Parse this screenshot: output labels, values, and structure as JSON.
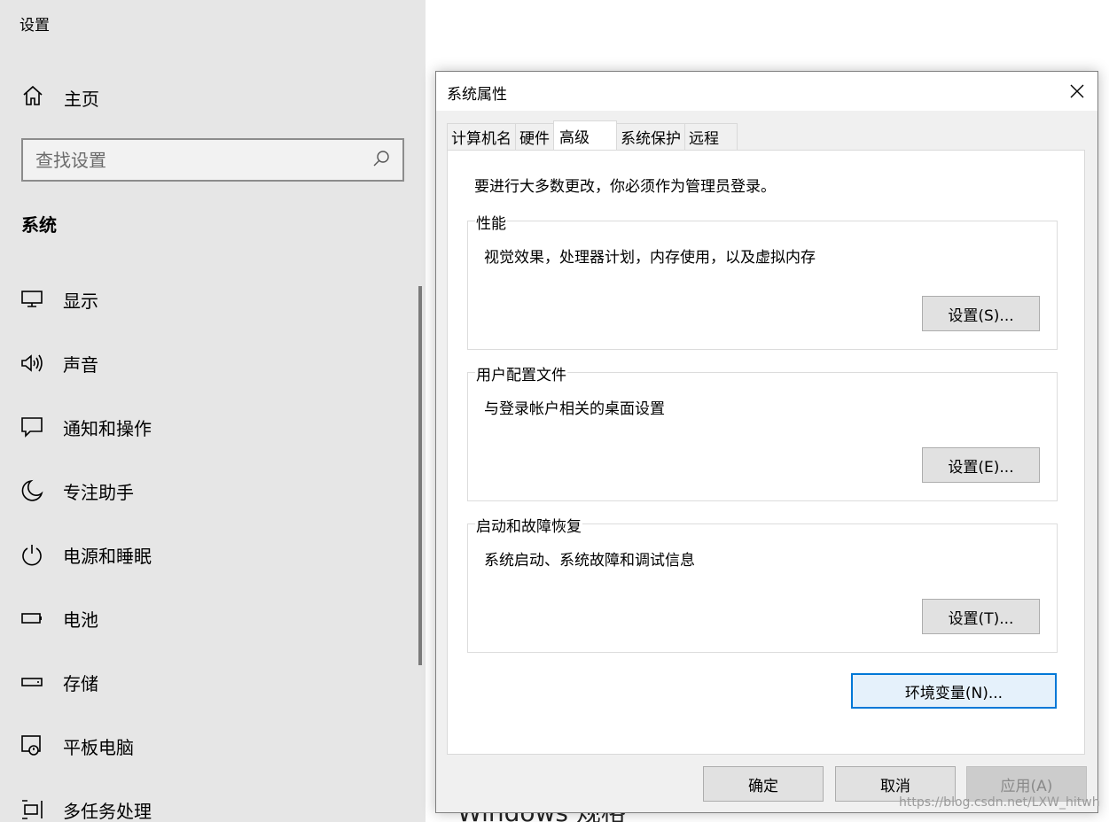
{
  "settings": {
    "app_title": "设置",
    "home_label": "主页",
    "search_placeholder": "查找设置",
    "section_title": "系统",
    "nav_items": [
      {
        "label": "显示",
        "icon": "monitor-icon"
      },
      {
        "label": "声音",
        "icon": "speaker-icon"
      },
      {
        "label": "通知和操作",
        "icon": "message-icon"
      },
      {
        "label": "专注助手",
        "icon": "moon-icon"
      },
      {
        "label": "电源和睡眠",
        "icon": "power-icon"
      },
      {
        "label": "电池",
        "icon": "battery-icon"
      },
      {
        "label": "存储",
        "icon": "storage-icon"
      },
      {
        "label": "平板电脑",
        "icon": "tablet-icon"
      },
      {
        "label": "多任务处理",
        "icon": "multitask-icon"
      }
    ],
    "background_text": "Windows 规格"
  },
  "dialog": {
    "title": "系统属性",
    "tabs": [
      {
        "label": "计算机名",
        "active": false
      },
      {
        "label": "硬件",
        "active": false
      },
      {
        "label": "高级",
        "active": true
      },
      {
        "label": "系统保护",
        "active": false
      },
      {
        "label": "远程",
        "active": false
      }
    ],
    "admin_note": "要进行大多数更改，你必须作为管理员登录。",
    "groups": [
      {
        "legend": "性能",
        "desc": "视觉效果，处理器计划，内存使用，以及虚拟内存",
        "button": "设置(S)..."
      },
      {
        "legend": "用户配置文件",
        "desc": "与登录帐户相关的桌面设置",
        "button": "设置(E)..."
      },
      {
        "legend": "启动和故障恢复",
        "desc": "系统启动、系统故障和调试信息",
        "button": "设置(T)..."
      }
    ],
    "env_button": "环境变量(N)...",
    "ok_button": "确定",
    "cancel_button": "取消",
    "apply_button": "应用(A)"
  },
  "watermark": "https://blog.csdn.net/LXW_hitwh"
}
